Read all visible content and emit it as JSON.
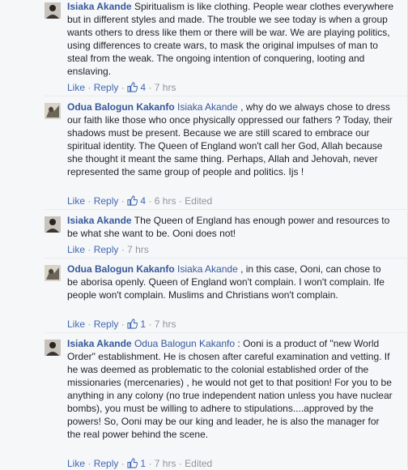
{
  "actions_labels": {
    "like": "Like",
    "reply": "Reply",
    "dot": "·",
    "edited": "Edited"
  },
  "comments": [
    {
      "author": "Isiaka Akande",
      "mention": "",
      "text": "Spiritualism is like clothing. People wear clothes everywhere but in different styles and made. The trouble we see today is when a group wants others to dress like them or there will be war. We are playing politics, using differences to create wars, to mask the original impulses of man to steal from the weak. The ongoing intention of conquering, looting and enslaving.",
      "likes": "4",
      "time": "7 hrs",
      "edited": false,
      "avatar": "isiaka-avatar"
    },
    {
      "author": "Odua Balogun Kakanfo",
      "mention": "Isiaka Akande",
      "text": ", why do we always chose to dress our faith like those who once physically oppressed our fathers ? Today, their shadows must be present. Because we are still scared to embrace our spiritual identity. The Queen of England won't call her God, Allah because she thought it meant the same thing. Perhaps, Allah and Jehovah, never represented the same group of people and politics. Ijs !",
      "likes": "4",
      "time": "6 hrs",
      "edited": true,
      "avatar": "odua-avatar"
    },
    {
      "author": "Isiaka Akande",
      "mention": "",
      "text": "The Queen of England has enough power and resources to be what she want to be. Ooni does not!",
      "likes": "",
      "time": "7 hrs",
      "edited": false,
      "avatar": "isiaka-avatar"
    },
    {
      "author": "Odua Balogun Kakanfo",
      "mention": "Isiaka Akande",
      "text": ", in this case, Ooni, can chose to be aborisa openly. Queen of England won't complain. I won't complain. Ife people won't complain. Muslims and Christians won't complain.",
      "likes": "1",
      "time": "7 hrs",
      "edited": false,
      "avatar": "odua-avatar"
    },
    {
      "author": "Isiaka Akande",
      "mention": "Odua Balogun Kakanfo",
      "text": ": Ooni is a product of \"new World Order\" establishment. He is chosen after careful examination and vetting. If he was deemed as problematic to the colonial established order of the missionaries (mercenaries) , he would not get to that position! For you to be anything in any colony (no true independent nation unless you have nuclear bombs), you must be willing to adhere to stipulations....approved by the powers! So, Ooni may be our king and leader, he is also the manager for the real power behind the scene.",
      "likes": "1",
      "time": "7 hrs",
      "edited": true,
      "avatar": "isiaka-avatar"
    }
  ]
}
